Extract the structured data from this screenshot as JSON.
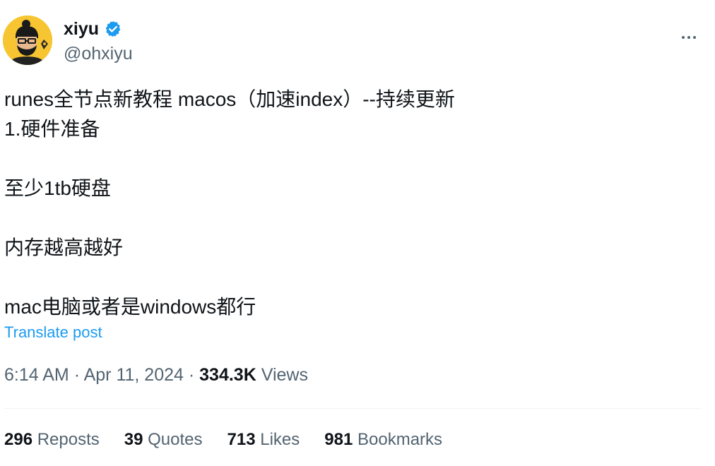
{
  "author": {
    "display_name": "xiyu",
    "handle": "@ohxiyu",
    "verified": true,
    "avatar_icon": "avatar-icon",
    "badge_color": "#1d9bf0"
  },
  "menu": {
    "more_icon": "more-icon"
  },
  "tweet": {
    "lines": [
      "runes全节点新教程 macos（加速index）--持续更新",
      "1.硬件准备",
      "",
      "至少1tb硬盘",
      "",
      "内存越高越好",
      "",
      "mac电脑或者是windows都行"
    ]
  },
  "translate_label": "Translate post",
  "meta": {
    "time": "6:14 AM",
    "separator": "·",
    "date": "Apr 11, 2024",
    "views_count": "334.3K",
    "views_label": "Views"
  },
  "stats": [
    {
      "count": "296",
      "label": "Reposts"
    },
    {
      "count": "39",
      "label": "Quotes"
    },
    {
      "count": "713",
      "label": "Likes"
    },
    {
      "count": "981",
      "label": "Bookmarks"
    }
  ],
  "colors": {
    "text_primary": "#0f1419",
    "text_secondary": "#536471",
    "accent": "#1d9bf0",
    "avatar_bg": "#f7c531",
    "divider": "#eff3f4"
  }
}
